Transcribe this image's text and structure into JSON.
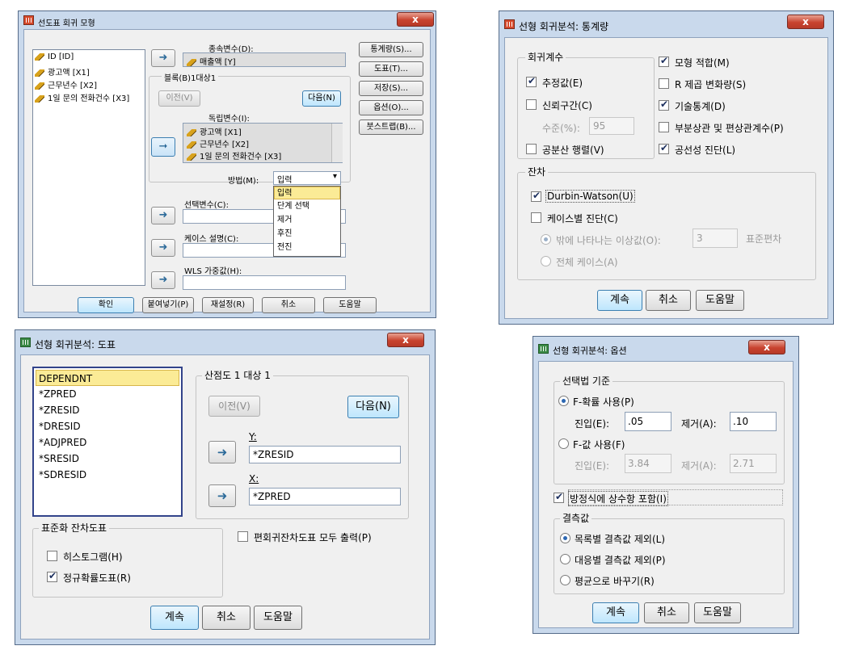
{
  "d1": {
    "title": "선도표 회귀 모형",
    "close": "x",
    "source_vars": [
      "ID [ID]",
      "광고액 [X1]",
      "근무년수 [X2]",
      "1일 문의 전화건수 [X3]"
    ],
    "dep_label": "종속변수(D):",
    "dep_value": "매출액 [Y]",
    "block_label": "블록(B)1대상1",
    "prev": "이전(V)",
    "next": "다음(N)",
    "indep_label": "독립변수(I):",
    "indep_vars": [
      "광고액 [X1]",
      "근무년수 [X2]",
      "1일 문의 전화건수 [X3]"
    ],
    "method_label": "방법(M):",
    "method_value": "입력",
    "method_options": [
      "입력",
      "단계 선택",
      "제거",
      "후진",
      "전진"
    ],
    "select_label": "선택변수(C):",
    "case_label": "케이스 설명(C):",
    "wls_label": "WLS 가중값(H):",
    "side_buttons": [
      "통계량(S)...",
      "도표(T)...",
      "저장(S)...",
      "옵션(O)...",
      "붓스트랩(B)..."
    ],
    "bottom_buttons": [
      "확인",
      "붙여넣기(P)",
      "재설정(R)",
      "취소",
      "도움말"
    ]
  },
  "d2": {
    "title": "선형 회귀분석: 통계량",
    "close": "x",
    "group_coef": "회귀계수",
    "estimates": "추정값(E)",
    "ci": "신뢰구간(C)",
    "level_label": "수준(%):",
    "level_value": "95",
    "covmatrix": "공분산 행렬(V)",
    "model_fit": "모형 적합(M)",
    "r_change": "R 제곱 변화량(S)",
    "descriptives": "기술통계(D)",
    "partial": "부분상관 및 편상관계수(P)",
    "collinearity": "공선성 진단(L)",
    "group_resid": "잔차",
    "durbin": "Durbin-Watson(U)",
    "casewise": "케이스별 진단(C)",
    "outliers": "밖에 나타나는 이상값(O):",
    "outliers_value": "3",
    "std_dev": "표준편차",
    "all_cases": "전체 케이스(A)",
    "buttons": [
      "계속",
      "취소",
      "도움말"
    ]
  },
  "d3": {
    "title": "선형 회귀분석: 도표",
    "close": "x",
    "vars": [
      "DEPENDNT",
      "*ZPRED",
      "*ZRESID",
      "*DRESID",
      "*ADJPRED",
      "*SRESID",
      "*SDRESID"
    ],
    "scatter_group": "산점도 1 대상 1",
    "prev": "이전(V)",
    "next": "다음(N)",
    "y_label": "Y:",
    "y_value": "*ZRESID",
    "x_label": "X:",
    "x_value": "*ZPRED",
    "std_group": "표준화 잔차도표",
    "histogram": "히스토그램(H)",
    "normal": "정규확률도표(R)",
    "partial": "편회귀잔차도표 모두 출력(P)",
    "buttons": [
      "계속",
      "취소",
      "도움말"
    ]
  },
  "d4": {
    "title": "선형 회귀분석: 옵션",
    "close": "x",
    "group_criteria": "선택법 기준",
    "use_f_prob": "F-확률 사용(P)",
    "entry_label": "진입(E):",
    "entry_prob": ".05",
    "removal_label": "제거(A):",
    "removal_prob": ".10",
    "use_f_value": "F-값 사용(F)",
    "entry_f": "3.84",
    "removal_f": "2.71",
    "include_const": "방정식에 상수항 포함(I)",
    "group_missing": "결측값",
    "listwise": "목록별 결측값 제외(L)",
    "pairwise": "대응별 결측값 제외(P)",
    "replace_mean": "평균으로 바꾸기(R)",
    "buttons": [
      "계속",
      "취소",
      "도움말"
    ]
  }
}
